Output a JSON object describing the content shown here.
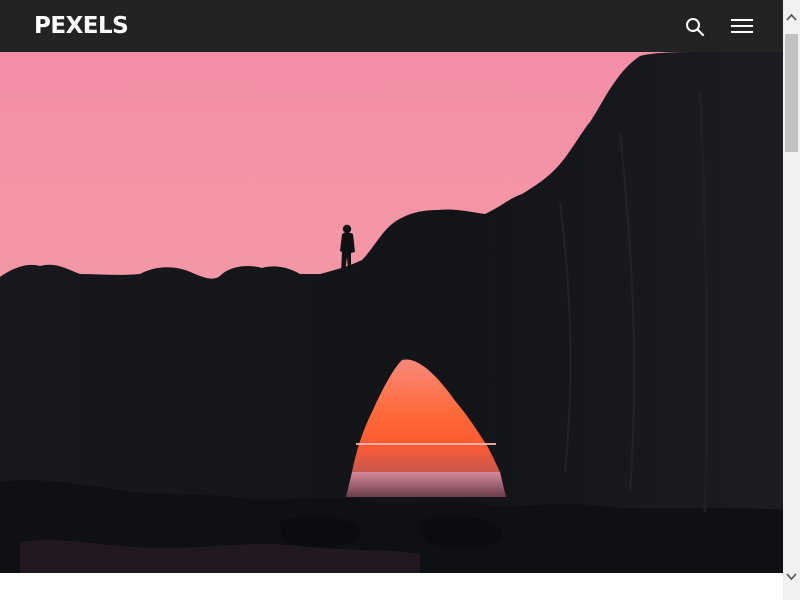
{
  "header": {
    "logo_text": "PEXELS",
    "search_icon": "search-icon",
    "menu_icon": "hamburger-menu-icon",
    "background_color": "#232323"
  },
  "hero": {
    "image_subject": "silhouette-rock-arch-sunset",
    "sky_color_top": "#f48fa3",
    "sky_color_horizon": "#f9a49e",
    "rock_color": "#141418",
    "sunset_glow": "#ff6a3d"
  },
  "scrollbar": {
    "up_icon": "chevron-up-icon",
    "down_icon": "chevron-down-icon"
  }
}
